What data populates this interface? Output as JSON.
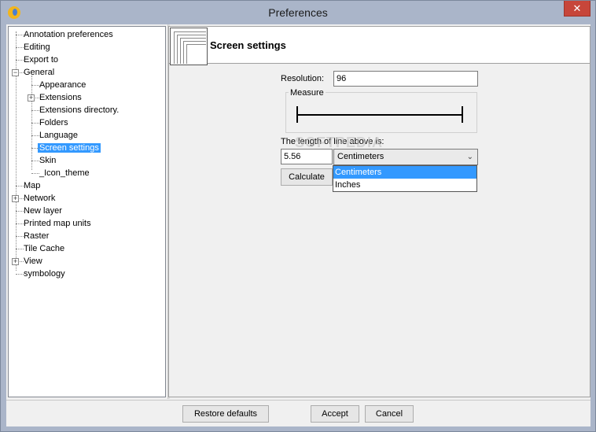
{
  "window": {
    "title": "Preferences",
    "close_label": "✕"
  },
  "tree": {
    "items": [
      {
        "label": "Annotation preferences"
      },
      {
        "label": "Editing"
      },
      {
        "label": "Export to"
      },
      {
        "label": "General",
        "expander": "−"
      },
      {
        "label": "Appearance"
      },
      {
        "label": "Extensions",
        "expander": "+"
      },
      {
        "label": "Extensions directory."
      },
      {
        "label": "Folders"
      },
      {
        "label": "Language"
      },
      {
        "label": "Screen settings",
        "selected": true
      },
      {
        "label": "Skin"
      },
      {
        "label": "_Icon_theme"
      },
      {
        "label": "Map"
      },
      {
        "label": "Network",
        "expander": "+"
      },
      {
        "label": "New layer"
      },
      {
        "label": "Printed map units"
      },
      {
        "label": "Raster"
      },
      {
        "label": "Tile Cache"
      },
      {
        "label": "View",
        "expander": "+"
      },
      {
        "label": "symbology"
      }
    ]
  },
  "panel": {
    "title": "Screen settings",
    "resolution_label": "Resolution:",
    "resolution_value": "96",
    "measure_label": "Measure",
    "length_label": "The length of line above is:",
    "length_value": "5.56",
    "unit_selected": "Centimeters",
    "unit_options": [
      "Centimeters",
      "Inches"
    ],
    "calculate_label": "Calculate"
  },
  "watermark": "SOFTPEDIA",
  "footer": {
    "restore_label": "Restore defaults",
    "accept_label": "Accept",
    "cancel_label": "Cancel"
  },
  "colors": {
    "selection": "#3399ff",
    "close": "#c7463a"
  }
}
